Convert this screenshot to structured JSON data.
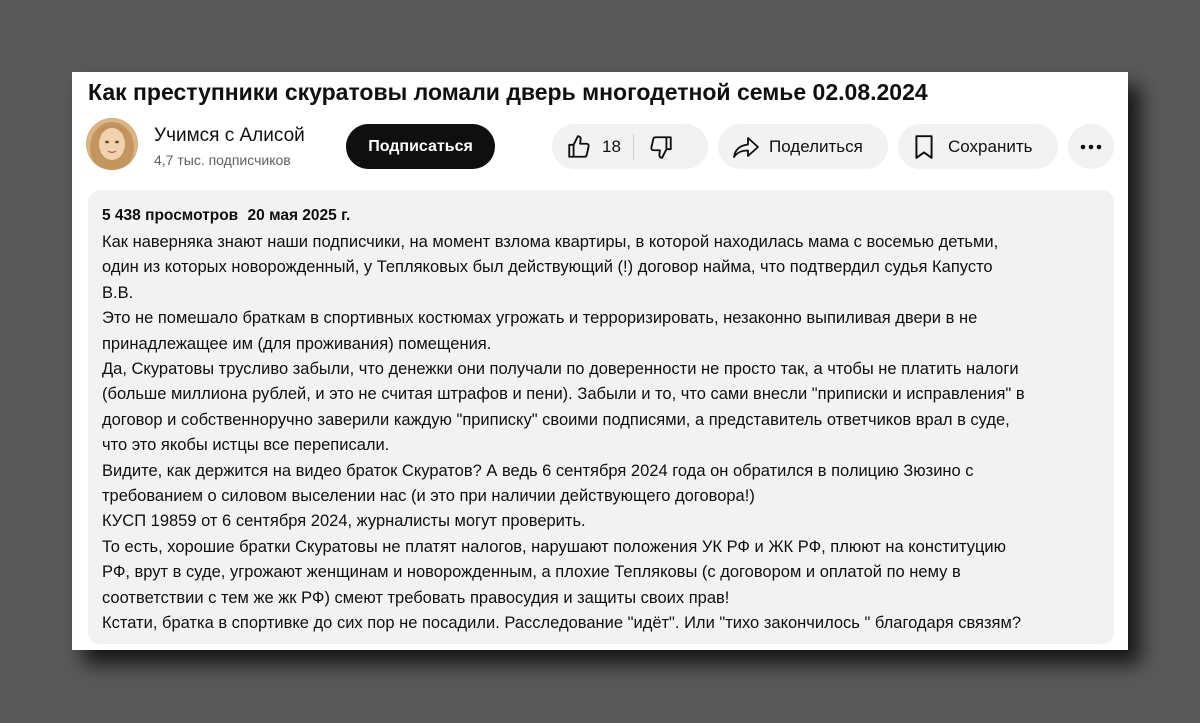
{
  "video": {
    "title": "Как преступники скуратовы ломали дверь многодетной семье 02.08.2024"
  },
  "channel": {
    "name": "Учимся с Алисой",
    "subscribers": "4,7 тыс. подписчиков",
    "avatar_icon": "avatar-photo"
  },
  "actions": {
    "subscribe_label": "Подписаться",
    "like_count": "18",
    "like_icon": "thumbs-up-icon",
    "dislike_icon": "thumbs-down-icon",
    "share_label": "Поделиться",
    "share_icon": "share-arrow-icon",
    "save_label": "Сохранить",
    "save_icon": "bookmark-icon",
    "more_icon": "more-dots-icon"
  },
  "description": {
    "views": "5 438 просмотров",
    "date": "20 мая 2025 г.",
    "lines": [
      "Как наверняка знают наши подписчики, на момент взлома квартиры, в которой находилась мама с восемью детьми,",
      "один из которых новорожденный, у Тепляковых был действующий (!) договор найма, что подтвердил судья Капусто",
      "В.В.",
      "Это не помешало браткам в спортивных костюмах угрожать и терроризировать, незаконно выпиливая двери в не",
      "принадлежащее им (для проживания) помещения.",
      "Да, Скуратовы трусливо забыли, что денежки они получали по доверенности не просто так, а чтобы не платить налоги",
      "(больше миллиона рублей, и это не считая штрафов и пени). Забыли и то, что сами внесли \"приписки и исправления\" в",
      "договор и собственноручно заверили каждую \"приписку\" своими подписями, а представитель ответчиков врал в суде,",
      "что это якобы истцы все переписали.",
      "Видите, как держится на видео браток Скуратов? А ведь 6 сентября 2024 года он обратился в полицию Зюзино с",
      "требованием о силовом выселении нас (и это при наличии действующего договора!)",
      "КУСП 19859 от 6 сентября 2024, журналисты могут проверить.",
      "То есть, хорошие братки Скуратовы не платят налогов, нарушают положения УК РФ и ЖК РФ, плюют на конституцию",
      "РФ, врут в суде, угрожают женщинам и новорожденным, а плохие Тепляковы (с договором и оплатой по нему в",
      "соответствии с тем же жк РФ) смеют требовать правосудия и защиты своих прав!",
      "Кстати, братка в спортивке до сих пор не посадили. Расследование \"идёт\". Или \"тихо закончилось \" благодаря связям?"
    ]
  },
  "colors": {
    "page_background": "#595959",
    "card_background": "#ffffff",
    "subscribe_background": "#0f0f0f",
    "pill_background": "#f2f2f2",
    "description_background": "#f2f2f2"
  }
}
